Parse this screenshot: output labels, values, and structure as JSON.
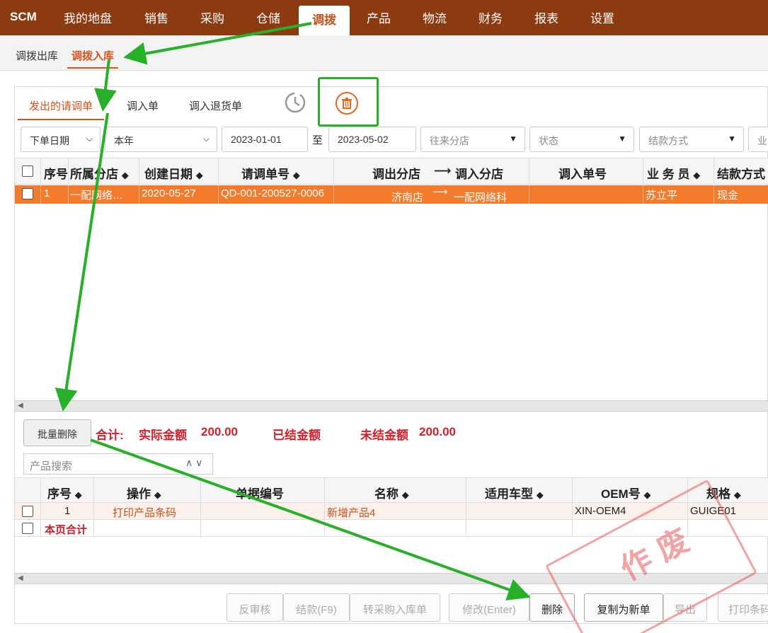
{
  "brand": "SCM",
  "nav": [
    "我的地盘",
    "销售",
    "采购",
    "仓储",
    "调拨",
    "产品",
    "物流",
    "财务",
    "报表",
    "设置"
  ],
  "nav_active": "调拨",
  "subtabs": [
    "调拨出库",
    "调拨入库"
  ],
  "tabs": [
    "发出的请调单",
    "调入单",
    "调入退货单"
  ],
  "filters": {
    "date_type": "下单日期",
    "period": "本年",
    "start_date": "2023-01-01",
    "to": "至",
    "end_date": "2023-05-02",
    "branch": "往来分店",
    "status": "状态",
    "settle": "结款方式",
    "more": "业"
  },
  "top_table": {
    "headers": [
      "序号",
      "所属分店",
      "创建日期",
      "请调单号",
      "调出分店",
      "调入分店",
      "调入单号",
      "业 务 员",
      "结款方式"
    ],
    "row": {
      "index": "1",
      "branch": "一配网络…",
      "date": "2020-05-27",
      "order_no": "QD-001-200527-0006",
      "from": "济南店",
      "to": "一配网络科",
      "in_no": "",
      "salesman": "苏立平",
      "settle": "现金"
    }
  },
  "batch_delete": "批量删除",
  "summary": {
    "label": "合计:",
    "actual_label": "实际金额",
    "actual_value": "200.00",
    "settled_label": "已结金额",
    "unsettled_label": "未结金额",
    "unsettled_value": "200.00"
  },
  "product_search_placeholder": "产品搜索",
  "bottom_table": {
    "headers": [
      "序号",
      "操作",
      "单据编号",
      "名称",
      "适用车型",
      "OEM号",
      "规格"
    ],
    "row": {
      "index": "1",
      "action": "打印产品条码",
      "doc_no": "",
      "name": "新增产品4",
      "car": "",
      "oem": "XIN-OEM4",
      "spec": "GUIGE01"
    },
    "total_label": "本页合计"
  },
  "buttons": [
    "反审核",
    "结款(F9)",
    "转采购入库单",
    "修改(Enter)",
    "删除",
    "复制为新单",
    "导出",
    "打印条码"
  ],
  "stamp": "作废",
  "colors": {
    "nav_bg": "#8c3a10",
    "accent": "#d4521c",
    "row_highlight": "#f47a2c",
    "annotation": "#28b02a"
  }
}
